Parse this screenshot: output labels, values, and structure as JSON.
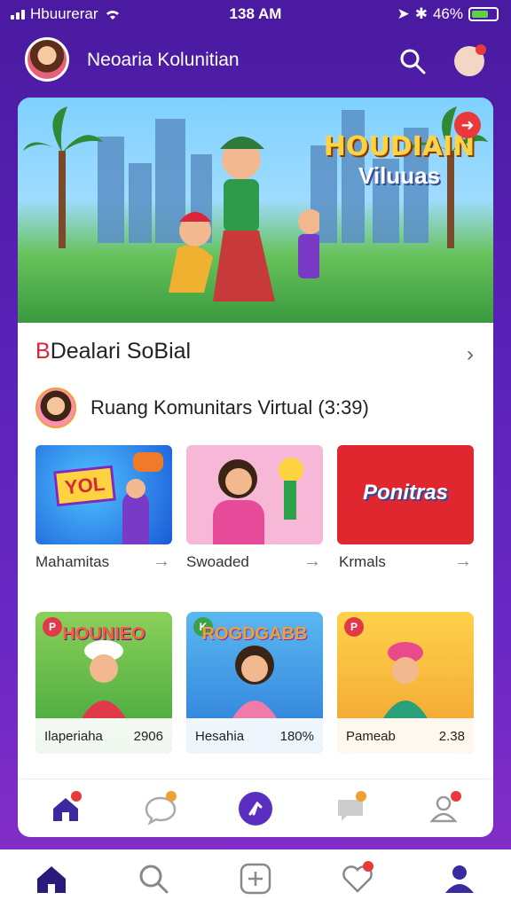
{
  "status": {
    "carrier": "Hbuurerar",
    "time": "138 AM",
    "battery": "46%"
  },
  "header": {
    "title": "Neoaria Kolunitian"
  },
  "hero": {
    "title_line1": "HOUDIAIN",
    "title_line2": "Viluuas",
    "badge": "➜"
  },
  "section": {
    "mark": "B",
    "title": "Dealari SoBial",
    "chevron": "›"
  },
  "subheader": {
    "text": "Ruang Komunitars Virtual (3:39)"
  },
  "row1": [
    {
      "label": "Mahamitas",
      "banner": "YOL"
    },
    {
      "label": "Swoaded",
      "banner": ""
    },
    {
      "label": "Krmals",
      "banner": "Ponitras"
    }
  ],
  "row2": [
    {
      "title": "HOUNIEO",
      "name": "Ilaperiaha",
      "value": "2906",
      "corner": "P",
      "corner_color": "#e03a4a"
    },
    {
      "title": "ROGDGABB",
      "name": "Hesahia",
      "value": "180%",
      "corner": "K",
      "corner_color": "#3aa04a"
    },
    {
      "title": "",
      "name": "Pameab",
      "value": "2.38",
      "corner": "P",
      "corner_color": "#e03a4a"
    }
  ],
  "colors": {
    "accent": "#5a2ec0",
    "notif": "#e83a3a",
    "orange": "#f0a030"
  }
}
